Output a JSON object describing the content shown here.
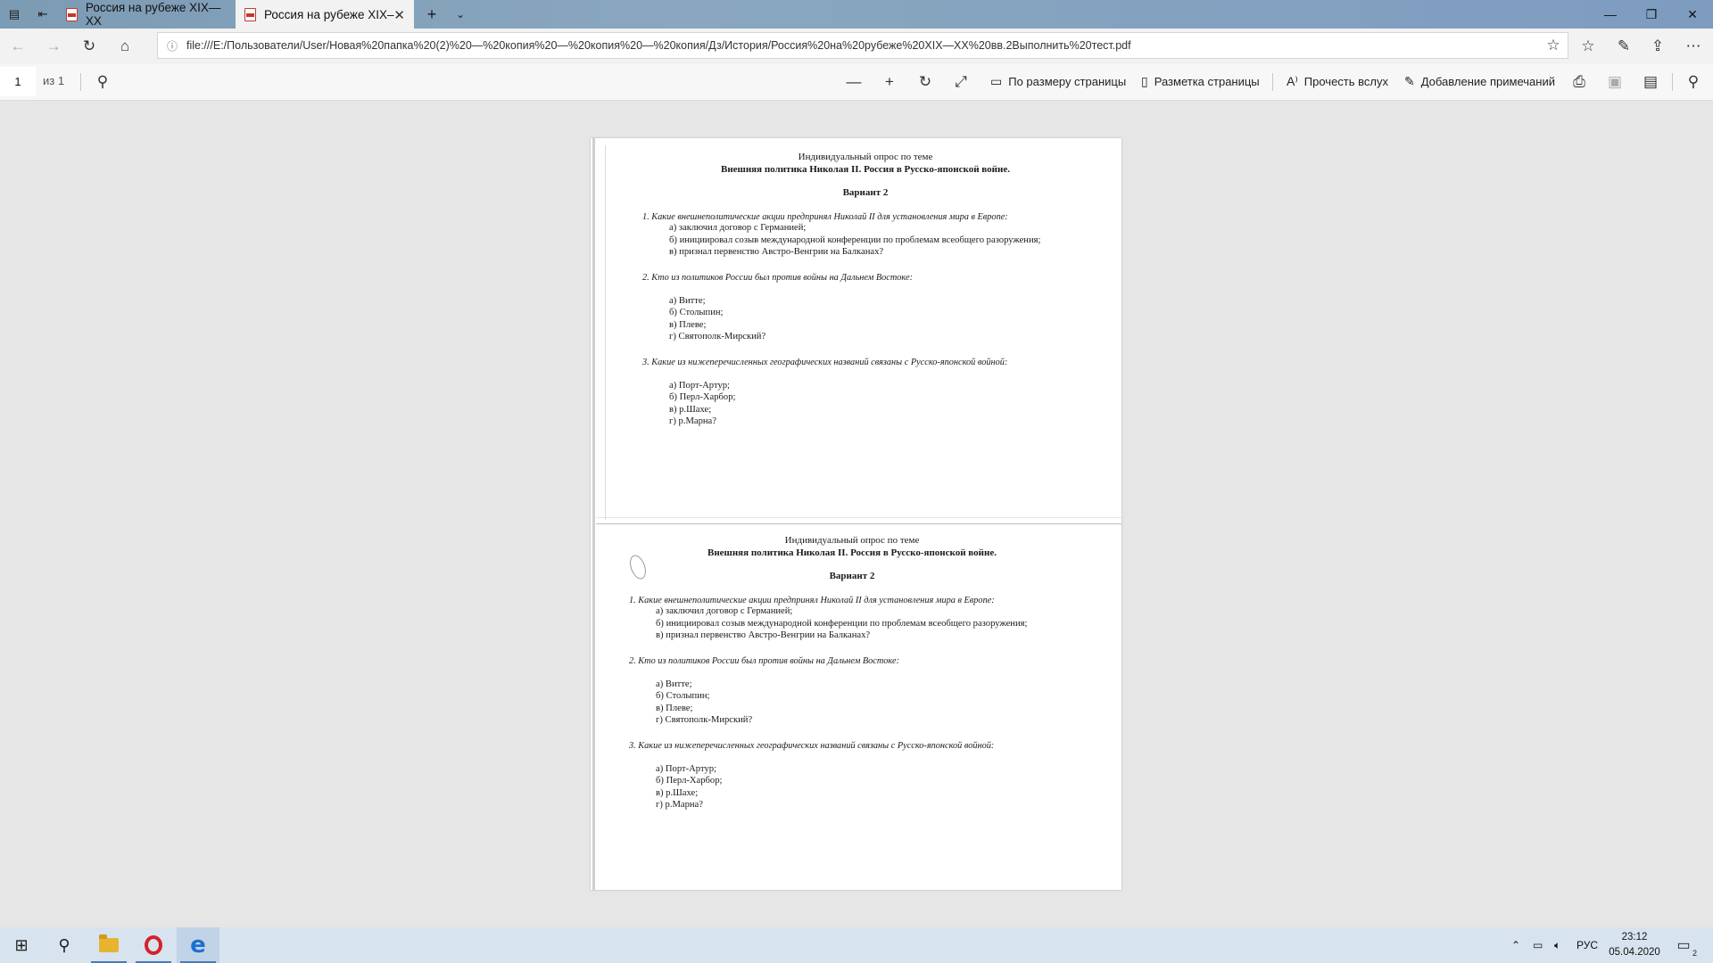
{
  "browser": {
    "tabs": [
      {
        "title": "Россия на рубеже XIX—XX",
        "active": false
      },
      {
        "title": "Россия на рубеже XIX–",
        "active": true
      }
    ],
    "new_tab_symbol": "+",
    "address_url": "file:///E:/Пользователи/User/Новая%20папка%20(2)%20—%20копия%20—%20копия%20—%20копия/Дз/История/Россия%20на%20рубеже%20XIX—XX%20вв.2Выполнить%20тест.pdf"
  },
  "pdf_toolbar": {
    "page_number": "1",
    "page_total": "из 1",
    "fit_page_label": "По размеру страницы",
    "page_layout_label": "Разметка страницы",
    "read_aloud_label": "Прочесть вслух",
    "add_notes_label": "Добавление примечаний"
  },
  "document": {
    "title_line1": "Индивидуальный опрос по теме",
    "title_line2": "Внешняя политика Николая II. Россия в Русско-японской войне.",
    "variant": "Вариант 2",
    "q1": "1. Какие внешнеполитические акции предпринял Николай II для установления мира в Европе:",
    "q1_a": "а) заключил договор с Германией;",
    "q1_b": "б) инициировал созыв международной конференции по проблемам всеобщего разоружения;",
    "q1_c": "в) признал первенство Австро-Венгрии на Балканах?",
    "q2": "2. Кто из политиков России был против войны на Дальнем Востоке:",
    "q2_a": "а) Витте;",
    "q2_b": "б) Столыпин;",
    "q2_c": "в) Плеве;",
    "q2_d": "г) Святополк-Мирский?",
    "q3": "3. Какие из нижеперечисленных географических названий связаны с Русско-японской войной:",
    "q3_a": "а) Порт-Артур;",
    "q3_b": "б) Перл-Харбор;",
    "q3_c": "в) р.Шахе;",
    "q3_d": "г) р.Марна?"
  },
  "taskbar": {
    "language": "РУС",
    "time": "23:12",
    "date": "05.04.2020",
    "notification_count": "2"
  },
  "colors": {
    "titlebar": "#8aa7bf",
    "taskbar": "#d7e3ee",
    "pdf_icon_red": "#c0392b",
    "edge_blue": "#1a6fd1"
  }
}
